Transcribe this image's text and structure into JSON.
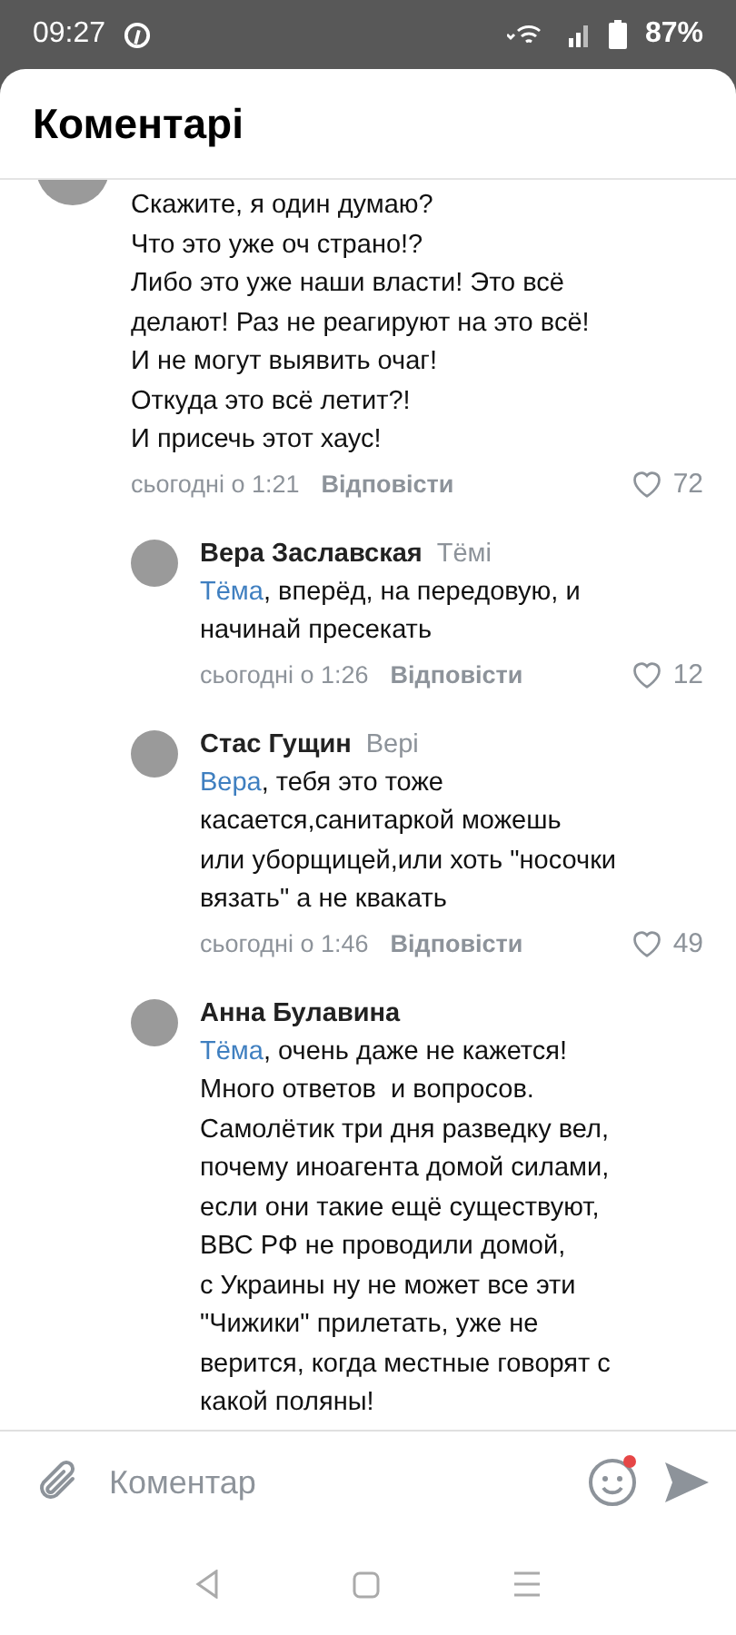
{
  "status_bar": {
    "time": "09:27",
    "battery": "87%"
  },
  "header": {
    "title": "Коментарі"
  },
  "comments": [
    {
      "kind": "top",
      "lines": [
        "Скажите, я один думаю?",
        "Что это уже оч страно!?",
        "Либо это уже наши власти! Это всё",
        "делают! Раз не реагируют на это всё!",
        "И не могут выявить очаг!",
        "Откуда это всё летит?!",
        "И присечь этот хаус!"
      ],
      "time": "сьогодні о 1:21",
      "reply_label": "Відповісти",
      "likes": "72"
    },
    {
      "kind": "reply",
      "author": "Вера Заславская",
      "reply_to": "Тёмі",
      "mention": "Тёма",
      "lines": [
        ", вперёд, на передовую, и",
        "начинай пресекать"
      ],
      "time": "сьогодні о 1:26",
      "reply_label": "Відповісти",
      "likes": "12"
    },
    {
      "kind": "reply",
      "author": "Стас Гущин",
      "reply_to": "Вері",
      "mention": "Вера",
      "lines": [
        ", тебя это тоже",
        "касается,санитаркой можешь",
        "или уборщицей,или хоть \"носочки",
        "вязать\" а не квакать"
      ],
      "time": "сьогодні о 1:46",
      "reply_label": "Відповісти",
      "likes": "49"
    },
    {
      "kind": "reply",
      "author": "Анна Булавина",
      "mention": "Тёма",
      "lines": [
        ", очень даже не кажется!",
        "Много ответов  и вопросов.",
        "Самолётик три дня разведку вел,",
        "почему иноагента домой силами,",
        "если они такие ещё существуют,",
        "ВВС РФ не проводили домой,",
        "с Украины ну не может все эти",
        "\"Чижики\" прилетать, уже не",
        "верится, когда местные говорят с",
        "какой поляны!"
      ]
    }
  ],
  "composer": {
    "placeholder": "Коментар",
    "emoji_badge": true
  }
}
